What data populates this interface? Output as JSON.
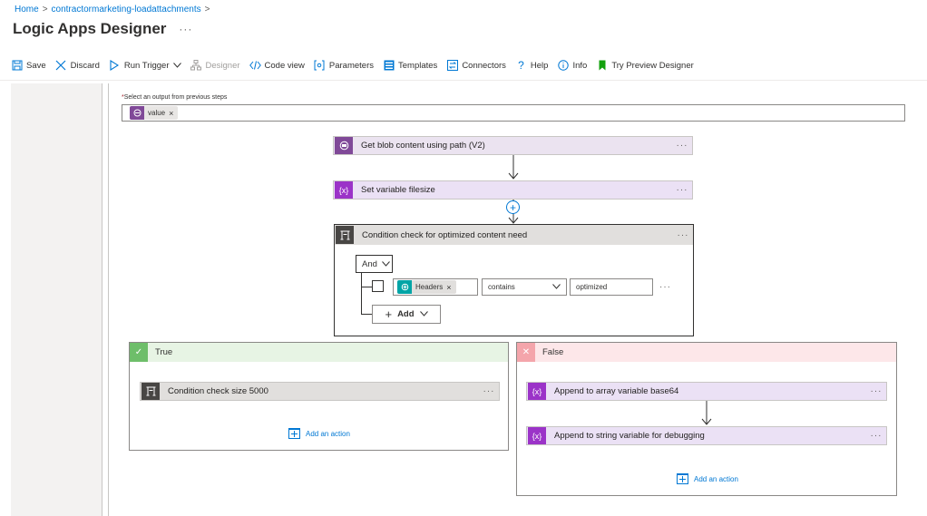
{
  "breadcrumb": {
    "home": "Home",
    "resource": "contractormarketing-loadattachments"
  },
  "page": {
    "title": "Logic Apps Designer",
    "more": "···"
  },
  "toolbar": {
    "save": "Save",
    "discard": "Discard",
    "run_trigger": "Run Trigger",
    "designer": "Designer",
    "code_view": "Code view",
    "parameters": "Parameters",
    "templates": "Templates",
    "connectors": "Connectors",
    "help": "Help",
    "info": "Info",
    "try_preview": "Try Preview Designer"
  },
  "foreach": {
    "required_mark": "*",
    "output_label": "Select an output from previous steps",
    "token": "value",
    "token_remove": "×"
  },
  "actions": {
    "get_blob": {
      "title": "Get blob content using path (V2)",
      "more": "···"
    },
    "set_variable": {
      "title": "Set variable filesize",
      "more": "···"
    },
    "add_step": "+"
  },
  "condition": {
    "title": "Condition check for optimized content need",
    "more": "···",
    "operator": "And",
    "row": {
      "token": "Headers",
      "token_remove": "×",
      "comparator": "contains",
      "value": "optimized",
      "more": "···"
    },
    "add_label": "Add"
  },
  "branches": {
    "true": {
      "label": "True",
      "icon": "✓",
      "action": {
        "title": "Condition check size 5000",
        "more": "···"
      },
      "add_action": "Add an action"
    },
    "false": {
      "label": "False",
      "icon": "✕",
      "actions": [
        {
          "title": "Append to array variable base64",
          "more": "···"
        },
        {
          "title": "Append to string variable for debugging",
          "more": "···"
        }
      ],
      "add_action": "Add an action"
    }
  },
  "colors": {
    "accent": "#0078d4",
    "variable_purple": "#9b33c8",
    "blob_purple": "#804998",
    "condition_gray": "#484644",
    "true_green": "#6ebe6a",
    "false_red": "#f4a5ab"
  }
}
